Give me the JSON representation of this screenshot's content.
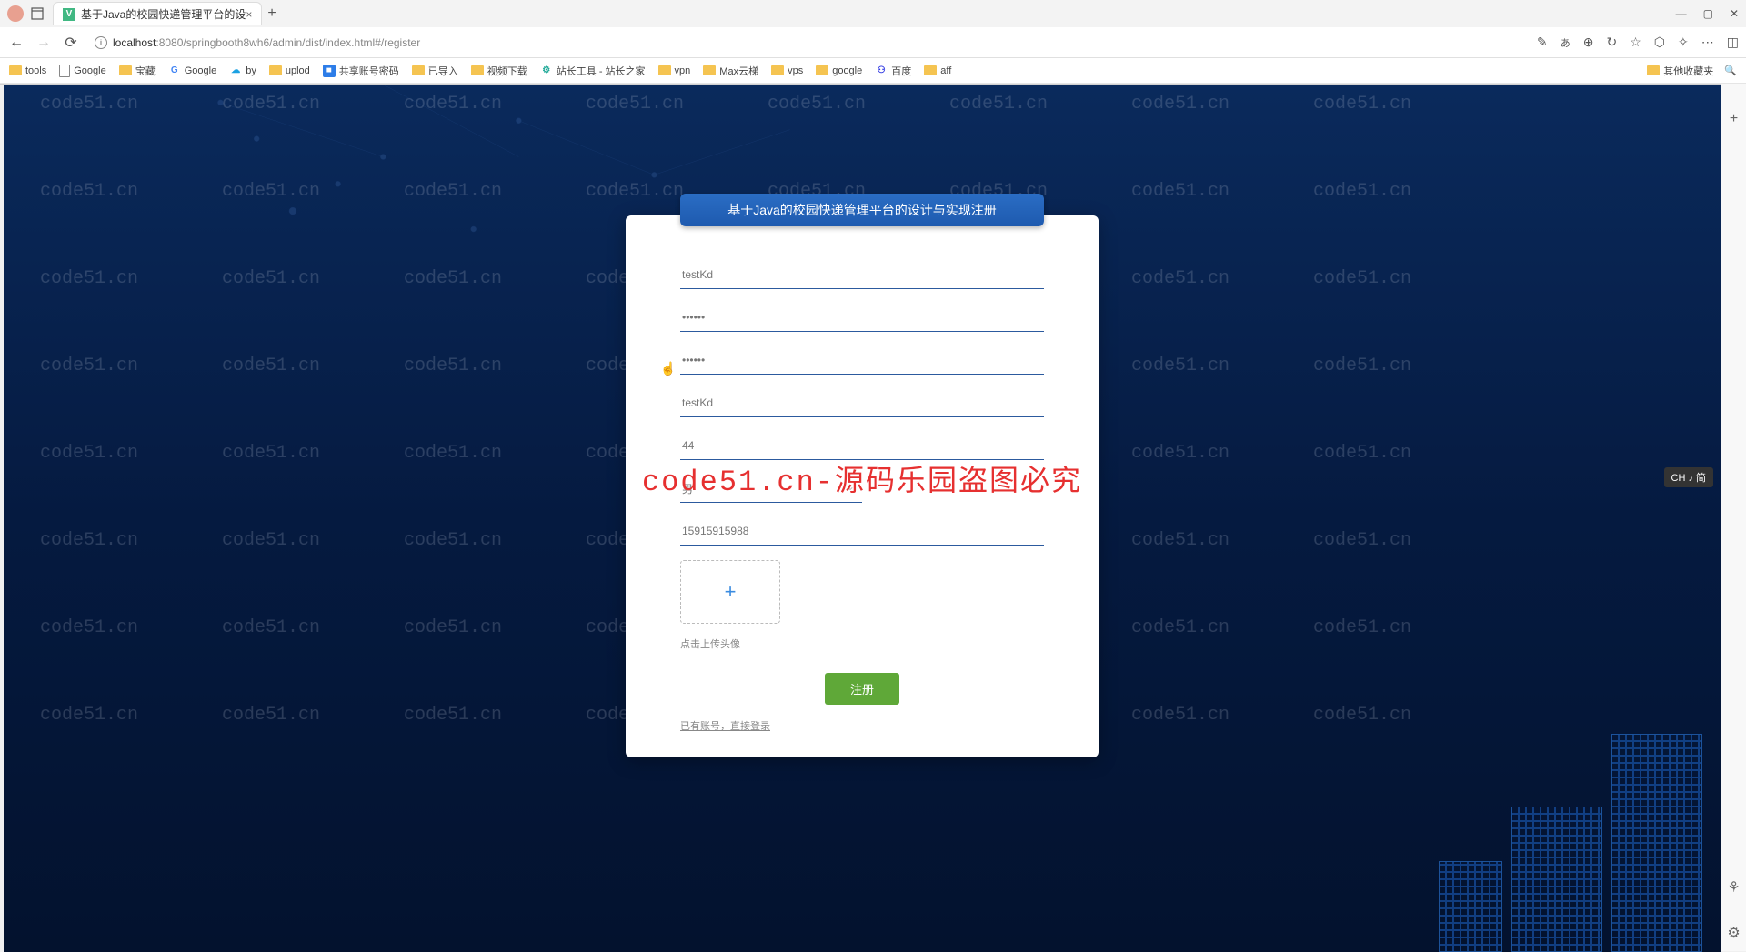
{
  "browser": {
    "tab_title": "基于Java的校园快递管理平台的设",
    "url_host": "localhost",
    "url_path": ":8080/springbooth8wh6/admin/dist/index.html#/register",
    "new_tab": "+"
  },
  "bookmarks": {
    "items": [
      {
        "label": "tools",
        "icon": "folder"
      },
      {
        "label": "Google",
        "icon": "page"
      },
      {
        "label": "宝藏",
        "icon": "folder"
      },
      {
        "label": "Google",
        "icon": "g"
      },
      {
        "label": "by",
        "icon": "cloud"
      },
      {
        "label": "uplod",
        "icon": "folder"
      },
      {
        "label": "共享账号密码",
        "icon": "app"
      },
      {
        "label": "已导入",
        "icon": "folder"
      },
      {
        "label": "视频下载",
        "icon": "folder"
      },
      {
        "label": "站长工具 - 站长之家",
        "icon": "tool"
      },
      {
        "label": "vpn",
        "icon": "folder"
      },
      {
        "label": "Max云梯",
        "icon": "folder"
      },
      {
        "label": "vps",
        "icon": "folder"
      },
      {
        "label": "google",
        "icon": "folder"
      },
      {
        "label": "百度",
        "icon": "baidu"
      },
      {
        "label": "aff",
        "icon": "folder"
      }
    ],
    "other": "其他收藏夹"
  },
  "form": {
    "header": "基于Java的校园快递管理平台的设计与实现注册",
    "username": "testKd",
    "password": "······",
    "confirm": "······",
    "realname": "testKd",
    "age": "44",
    "gender": "男",
    "phone": "15915915988",
    "upload_hint": "点击上传头像",
    "submit": "注册",
    "login_link": "已有账号，直接登录"
  },
  "watermark": {
    "text": "code51.cn",
    "main": "code51.cn-源码乐园盗图必究"
  },
  "ime": "CH ♪ 简"
}
